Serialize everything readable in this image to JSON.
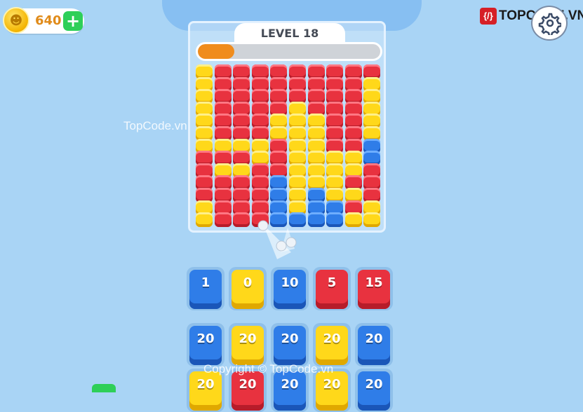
{
  "hud": {
    "coins": "640",
    "add_coin_label": "+",
    "level_label": "LEVEL 18",
    "progress_fraction": 0.2
  },
  "brand": {
    "mark": "{/}",
    "text": "TOPCODE.VN"
  },
  "watermarks": {
    "center": "TopCode.vn",
    "footer": "Copyright © TopCode.vn"
  },
  "colors": {
    "background": "#a9d4f5",
    "red": "#e8323f",
    "yellow": "#ffd81a",
    "blue": "#2f7de8",
    "coin": "#f4b400",
    "progress": "#f08c1c",
    "add_button": "#2ecf58"
  },
  "board_rows": [
    "YRRRRRRRRR",
    "YRRRRRRRRY",
    "YRRRRRRRRY",
    "YRRRRYRRRY",
    "YRRRYYYRRY",
    "YRRRYYYRRY",
    "YYYYRYYRRB",
    "RRRYRYYYYB",
    "RYYRRYYYYR",
    "RRRRBYYYRR",
    "RRRRBYBYYR",
    "YRRRBYBBRY",
    "YRRRBBBBYY"
  ],
  "shooters": [
    {
      "value": "1",
      "color": "b"
    },
    {
      "value": "0",
      "color": "y"
    },
    {
      "value": "10",
      "color": "b"
    },
    {
      "value": "5",
      "color": "r"
    },
    {
      "value": "15",
      "color": "r"
    },
    {
      "value": "20",
      "color": "b"
    },
    {
      "value": "20",
      "color": "y"
    },
    {
      "value": "20",
      "color": "b"
    },
    {
      "value": "20",
      "color": "y"
    },
    {
      "value": "20",
      "color": "b"
    },
    {
      "value": "20",
      "color": "y"
    },
    {
      "value": "20",
      "color": "r"
    },
    {
      "value": "20",
      "color": "b"
    },
    {
      "value": "20",
      "color": "y"
    },
    {
      "value": "20",
      "color": "b"
    }
  ],
  "icons": {
    "coin": "skull-coin-icon",
    "settings": "gear-icon"
  }
}
